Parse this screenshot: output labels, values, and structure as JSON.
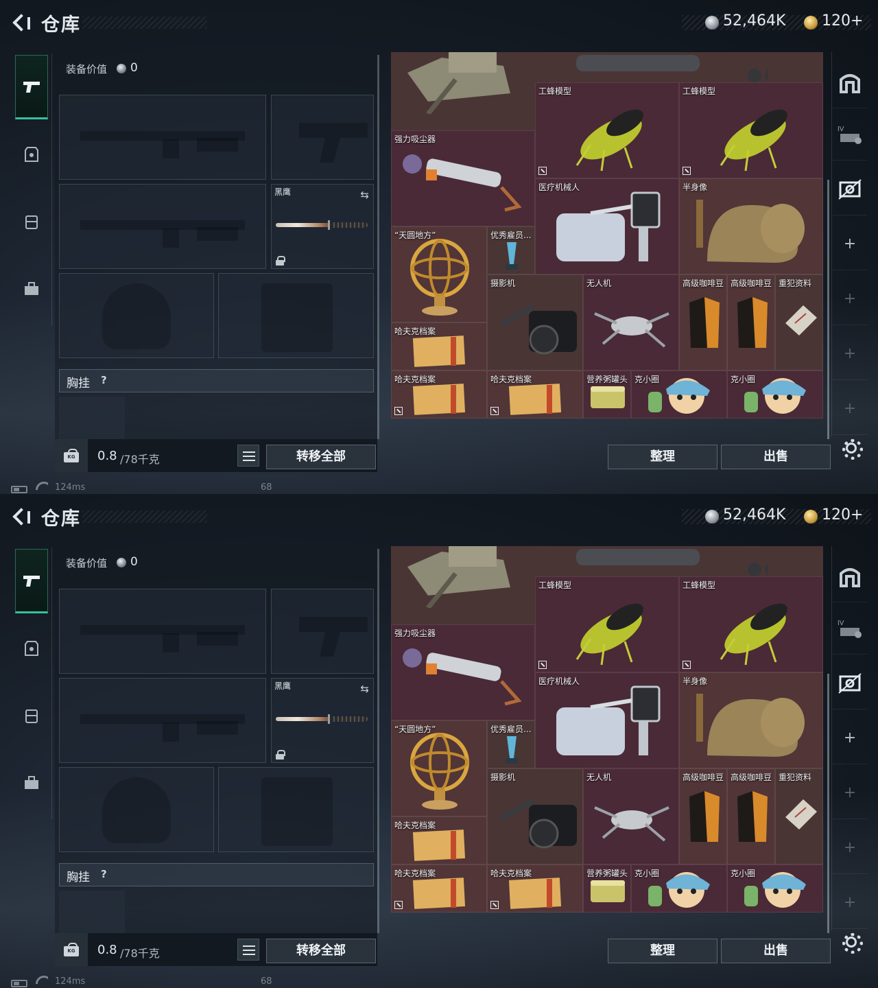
{
  "header": {
    "title": "仓库",
    "currency": "52,464K",
    "tickets": "120+"
  },
  "equipment": {
    "value_label": "装备价值",
    "value": "0",
    "slots": [
      {
        "name": "黑鹰"
      }
    ],
    "chest_rig": {
      "label": "胸挂",
      "help": "?"
    },
    "weight": {
      "current": "0.8",
      "max": "/78千克"
    },
    "transfer_all": "转移全部"
  },
  "stash": {
    "items": [
      {
        "name": "工蜂模型"
      },
      {
        "name": "工蜂模型"
      },
      {
        "name": "强力吸尘器"
      },
      {
        "name": "医疗机械人"
      },
      {
        "name": "半身像"
      },
      {
        "name": "“天圆地方”"
      },
      {
        "name": "优秀雇员..."
      },
      {
        "name": "摄影机"
      },
      {
        "name": "无人机"
      },
      {
        "name": "高级咖啡豆"
      },
      {
        "name": "高级咖啡豆"
      },
      {
        "name": "重犯资料"
      },
      {
        "name": "哈夫克档案"
      },
      {
        "name": "哈夫克档案"
      },
      {
        "name": "哈夫克档案"
      },
      {
        "name": "营养粥罐头"
      },
      {
        "name": "克小圈"
      },
      {
        "name": "克小圈"
      }
    ],
    "sort_button": "整理",
    "sell_button": "出售"
  },
  "status_bar": {
    "latency": "124ms",
    "fps": "68"
  },
  "colors": {
    "accent": "#35c29a",
    "stash_bg": "#3e1f26",
    "panel_bg": "#151c25"
  }
}
